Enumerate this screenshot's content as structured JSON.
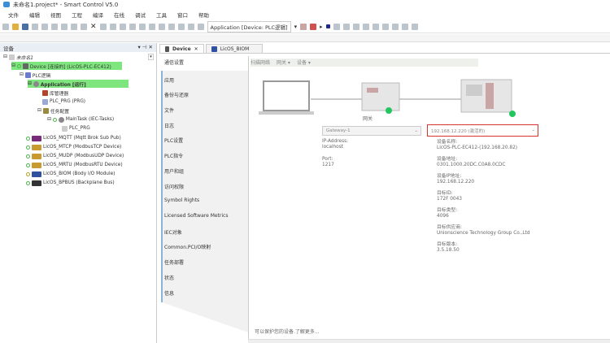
{
  "window": {
    "title": "未命名1.project* - Smart Control V5.0"
  },
  "menu": [
    "文件",
    "编辑",
    "视图",
    "工程",
    "编译",
    "在线",
    "调试",
    "工具",
    "窗口",
    "帮助"
  ],
  "toolbar": {
    "app_selector": "Application [Device: PLC逻辑]"
  },
  "device_panel": {
    "title": "设备",
    "tree": [
      {
        "label": "未命名1",
        "level": 0
      },
      {
        "label": "Device [连接的] (LicOS-PLC-EC412)",
        "level": 1,
        "highlight": true
      },
      {
        "label": "PLC逻辑",
        "level": 2
      },
      {
        "label": "Application [运行]",
        "level": 3,
        "highlight": true
      },
      {
        "label": "库管理器",
        "level": 4
      },
      {
        "label": "PLC_PRG (PRG)",
        "level": 4
      },
      {
        "label": "任务配置",
        "level": 4
      },
      {
        "label": "MainTask (IEC-Tasks)",
        "level": 5
      },
      {
        "label": "PLC_PRG",
        "level": 6
      },
      {
        "label": "LicOS_MQTT (Mqtt Brok Sub Pub)",
        "level": 2
      },
      {
        "label": "LicOS_MTCP (ModbusTCP Device)",
        "level": 2
      },
      {
        "label": "LicOS_MUDP (ModbusUDP Device)",
        "level": 2
      },
      {
        "label": "LicOS_MRTU (ModbusRTU Device)",
        "level": 2
      },
      {
        "label": "LicOS_BIOM (Body I/O Module)",
        "level": 2
      },
      {
        "label": "LicOS_BPBUS (Backplane Bus)",
        "level": 2
      }
    ]
  },
  "tabs": [
    {
      "label": "Device",
      "active": true
    },
    {
      "label": "LicOS_BIOM",
      "active": false
    }
  ],
  "side_nav": [
    "通信设置",
    "应用",
    "备份与还原",
    "文件",
    "日志",
    "PLC设置",
    "PLC指令",
    "用户和组",
    "访问权限",
    "Symbol Rights",
    "Licensed Software Metrics",
    "IEC对象",
    "Common.PCI/O映射",
    "任务部署",
    "状态",
    "信息"
  ],
  "comm": {
    "toolbar": [
      "扫描网络",
      "网关 ▾",
      "设备 ▾"
    ],
    "gateway_caption": "网关",
    "gateway_select": "Gateway-1",
    "device_select": "192.168.12.220 (激活的)",
    "gateway_info": [
      {
        "label": "IP-Address:",
        "value": "localhost"
      },
      {
        "label": "Port:",
        "value": "1217"
      }
    ],
    "device_info": [
      {
        "label": "设备名称:",
        "value": "LicOS-PLC-EC412-(192.168.20.82)"
      },
      {
        "label": "设备地址:",
        "value": "0301.1000.20DC.C0A8.0CDC"
      },
      {
        "label": "设备IP地址:",
        "value": "192.168.12.220"
      },
      {
        "label": "目标ID:",
        "value": "172F 0043"
      },
      {
        "label": "目标类型:",
        "value": "4096"
      },
      {
        "label": "目标供应商:",
        "value": "Unionscience Technology Group Co.,Ltd"
      },
      {
        "label": "目标版本:",
        "value": "3.5.18.50"
      }
    ],
    "footer": "可以保护您的设备.了解更多..."
  },
  "colors": {
    "highlight": "#7fe67f",
    "status_ok": "#22c55e",
    "selected_border": "#d9342b"
  }
}
